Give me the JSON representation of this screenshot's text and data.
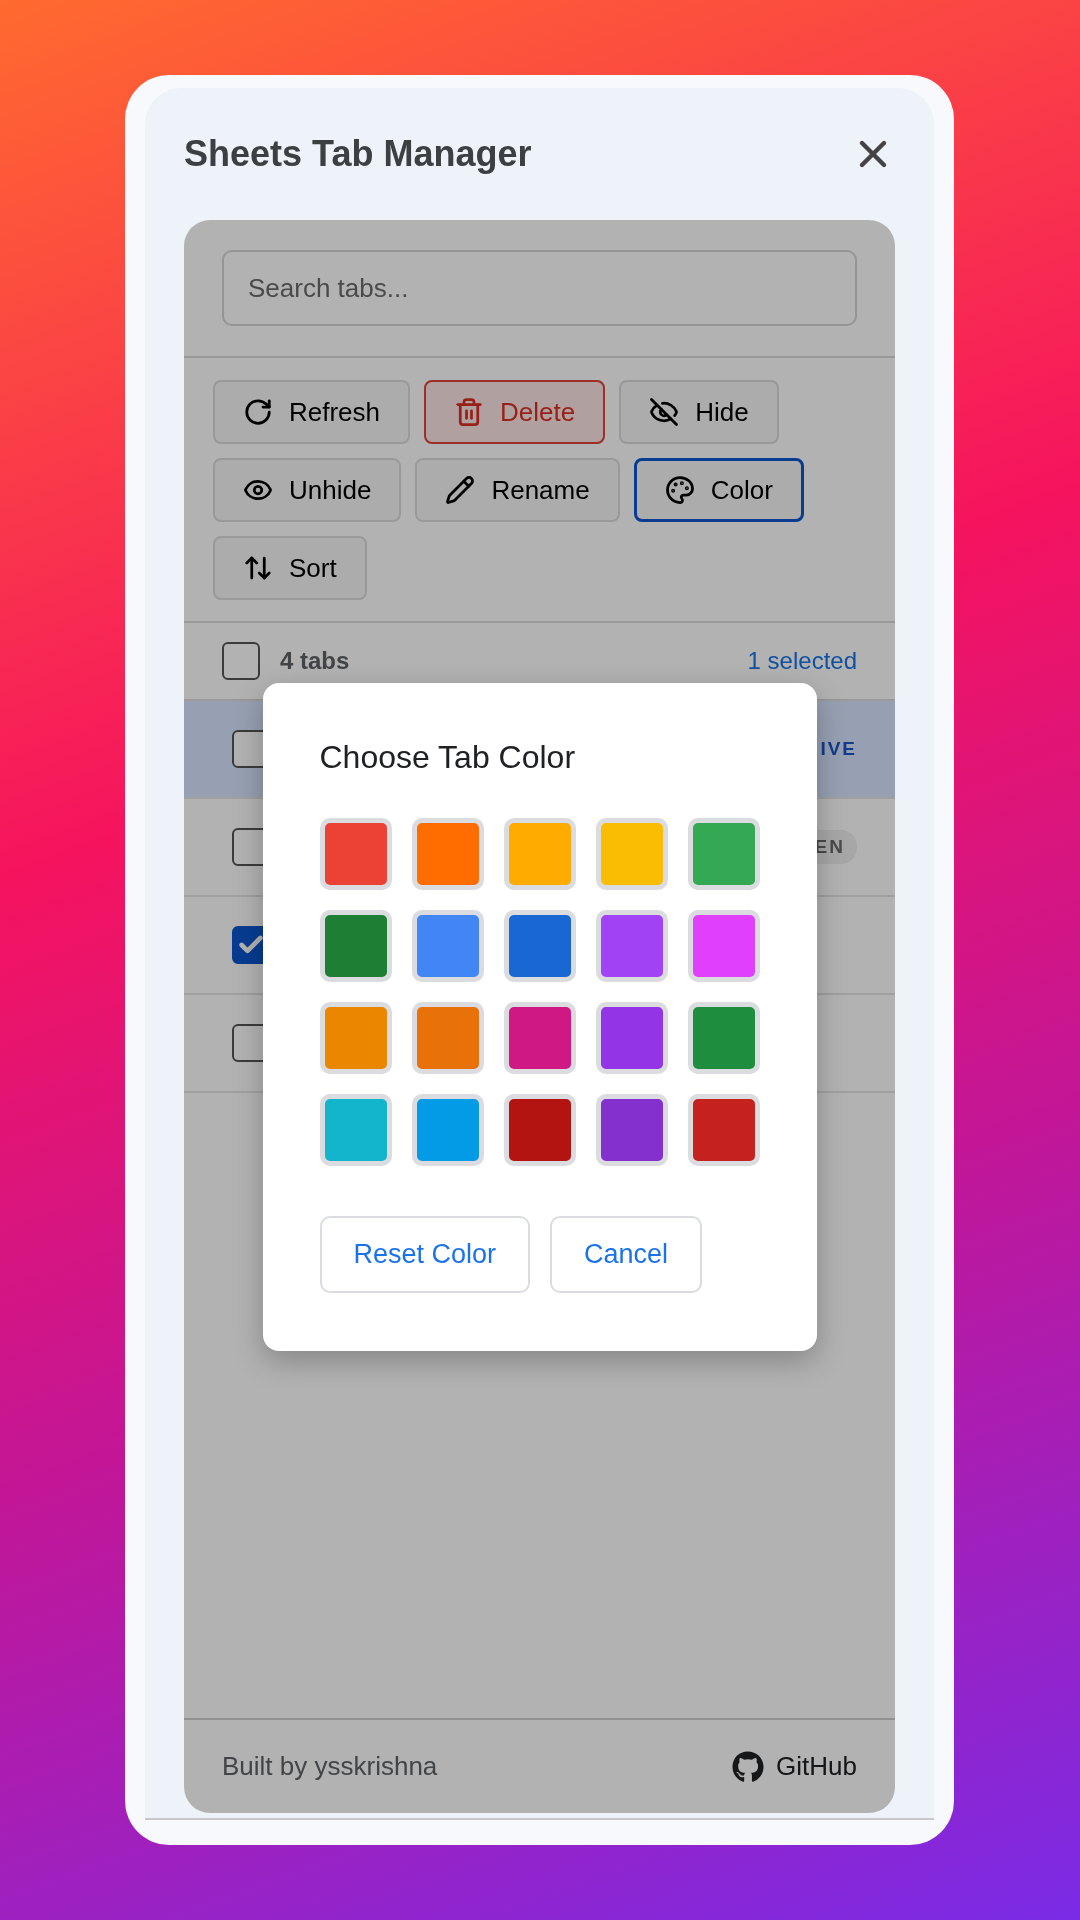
{
  "window": {
    "title": "Sheets Tab Manager"
  },
  "search": {
    "placeholder": "Search tabs..."
  },
  "toolbar": [
    {
      "label": "Refresh",
      "kind": "refresh",
      "selected": false
    },
    {
      "label": "Delete",
      "kind": "delete",
      "selected": false
    },
    {
      "label": "Hide",
      "kind": "hide",
      "selected": false
    },
    {
      "label": "Unhide",
      "kind": "unhide",
      "selected": false
    },
    {
      "label": "Rename",
      "kind": "rename",
      "selected": false
    },
    {
      "label": "Color",
      "kind": "color",
      "selected": true
    },
    {
      "label": "Sort",
      "kind": "sort",
      "selected": false
    }
  ],
  "list_header": {
    "checked": false,
    "count": "4 tabs",
    "selection": "1 selected"
  },
  "rows": [
    {
      "checked": false,
      "active": true,
      "badge": {
        "kind": "active",
        "text": "IVE"
      }
    },
    {
      "checked": false,
      "active": false,
      "badge": {
        "kind": "hidden",
        "text": "EN"
      }
    },
    {
      "checked": true,
      "active": false
    },
    {
      "checked": false,
      "active": false
    }
  ],
  "dialog": {
    "title": "Choose Tab Color",
    "swatches": [
      {
        "color": "#ea4335"
      },
      {
        "color": "#ff6d01"
      },
      {
        "color": "#ffab00"
      },
      {
        "color": "#fbbc04"
      },
      {
        "color": "#34a853"
      },
      {
        "color": "#1e7e34"
      },
      {
        "color": "#4285f4"
      },
      {
        "color": "#1967d2"
      },
      {
        "color": "#a142f4"
      },
      {
        "color": "#e040fb"
      },
      {
        "color": "#ea8600"
      },
      {
        "color": "#e8710a"
      },
      {
        "color": "#d01884"
      },
      {
        "color": "#9334e6"
      },
      {
        "color": "#1e8e3e"
      },
      {
        "color": "#12b5cb"
      },
      {
        "color": "#039be5"
      },
      {
        "color": "#b31412"
      },
      {
        "color": "#8430ce"
      },
      {
        "color": "#c5221f"
      }
    ],
    "buttons": [
      "Reset Color",
      "Cancel"
    ]
  },
  "footer": {
    "credit": "Built by ysskrishna",
    "link": "GitHub"
  }
}
